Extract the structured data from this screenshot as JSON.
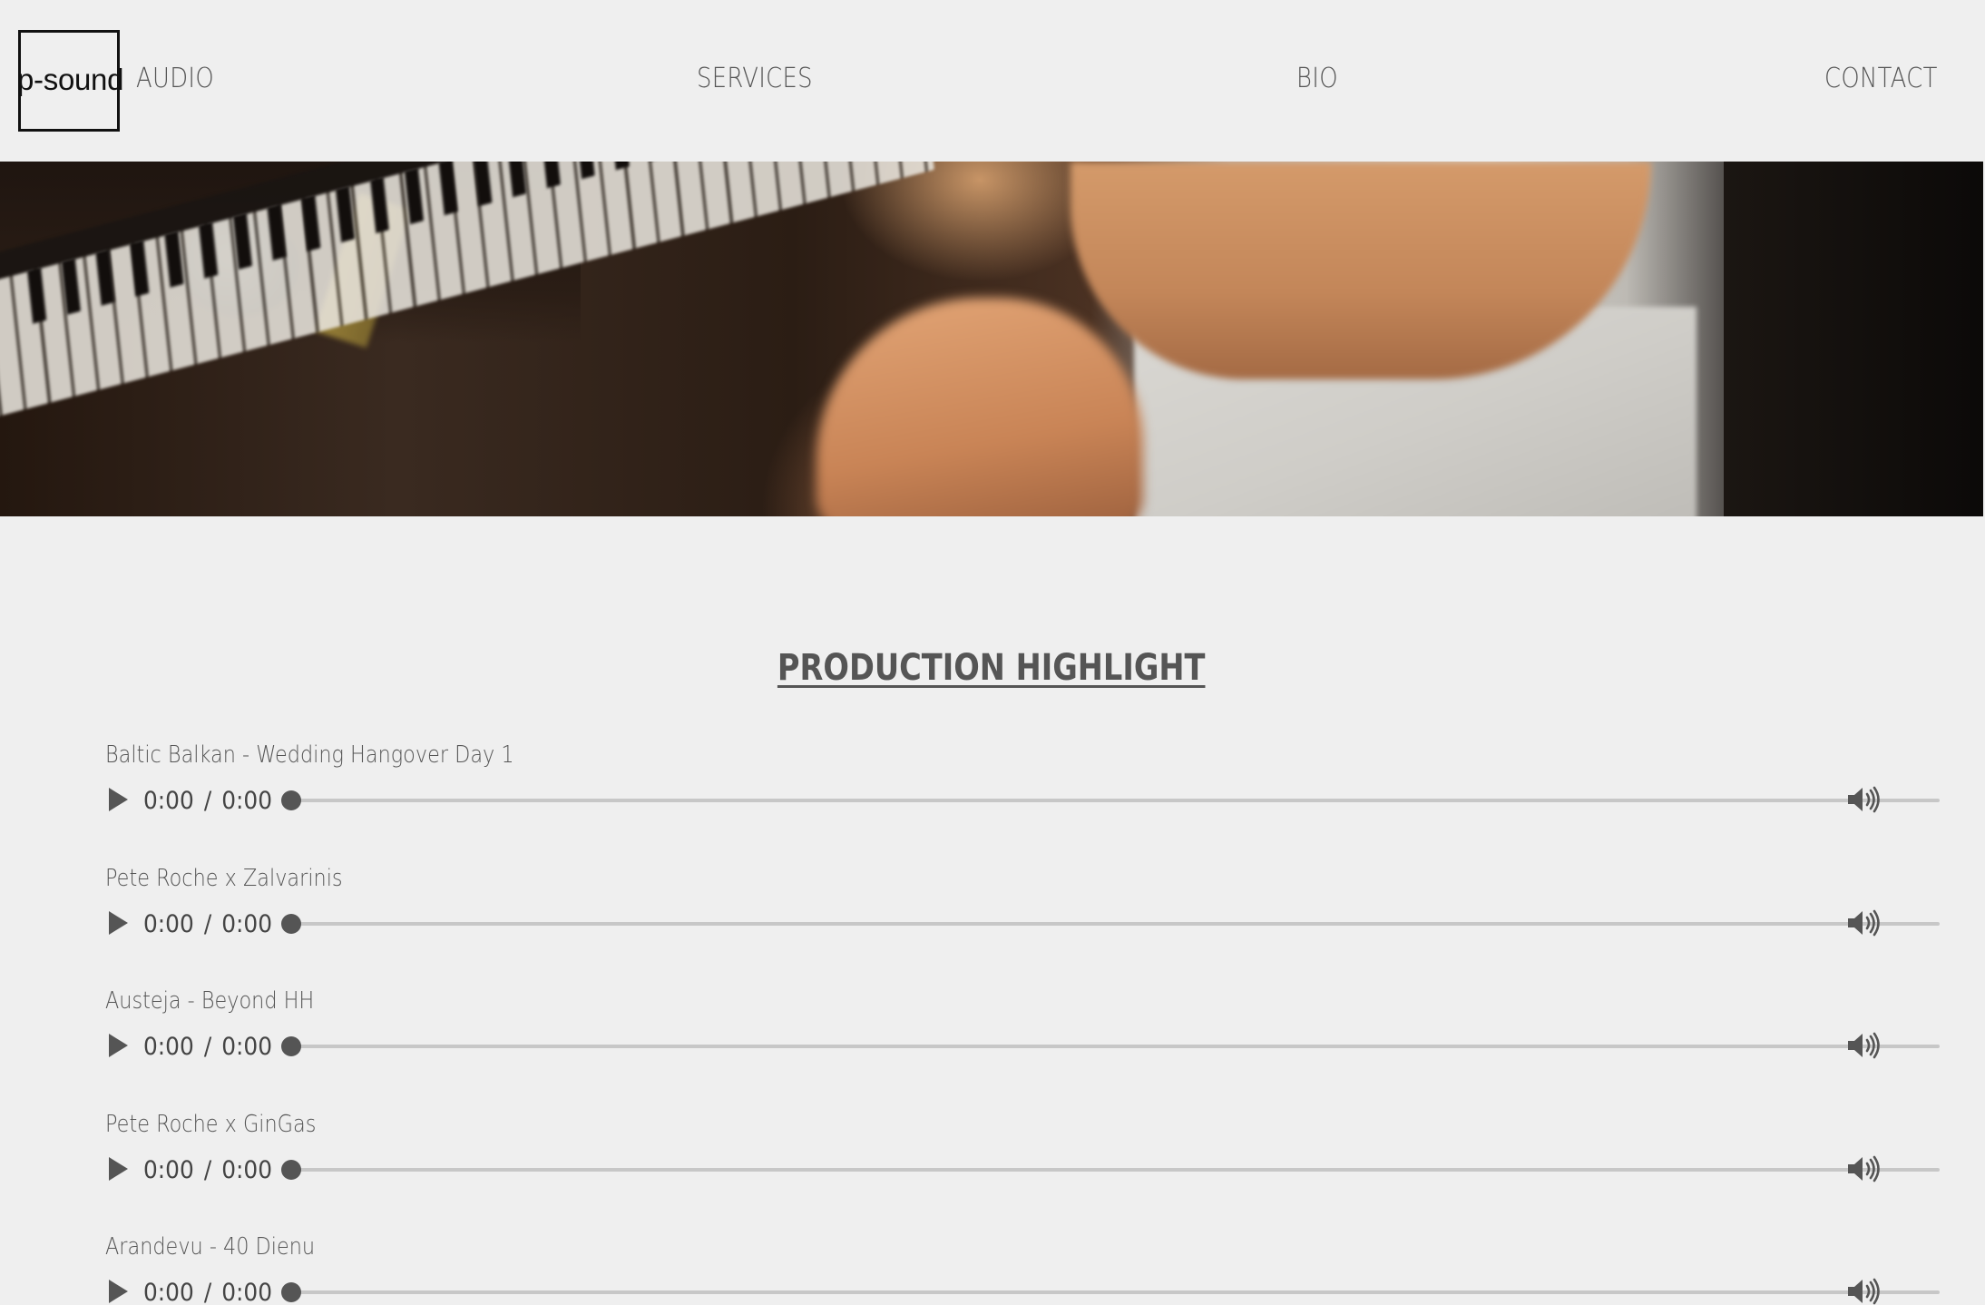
{
  "brand": {
    "logo_text": "p-sound"
  },
  "nav": {
    "items": [
      {
        "label": "AUDIO"
      },
      {
        "label": "SERVICES"
      },
      {
        "label": "BIO"
      },
      {
        "label": "CONTACT"
      }
    ]
  },
  "hero": {
    "image_description_icon": "studio-keyboard-photo"
  },
  "section": {
    "title": "PRODUCTION HIGHLIGHT"
  },
  "tracks": [
    {
      "title": "Baltic Balkan - Wedding Hangover Day 1",
      "current_time": "0:00",
      "duration": "0:00",
      "progress": 0
    },
    {
      "title": "Pete Roche x Zalvarinis",
      "current_time": "0:00",
      "duration": "0:00",
      "progress": 0
    },
    {
      "title": "Austeja - Beyond HH",
      "current_time": "0:00",
      "duration": "0:00",
      "progress": 0
    },
    {
      "title": "Pete Roche x GinGas",
      "current_time": "0:00",
      "duration": "0:00",
      "progress": 0
    },
    {
      "title": "Arandevu - 40 Dienu",
      "current_time": "0:00",
      "duration": "0:00",
      "progress": 0
    }
  ],
  "player": {
    "time_separator": "/",
    "play_icon": "play-icon",
    "volume_icon": "volume-icon"
  },
  "colors": {
    "background": "#efefef",
    "text": "#555555",
    "scrub_track": "#c7c7c7"
  }
}
